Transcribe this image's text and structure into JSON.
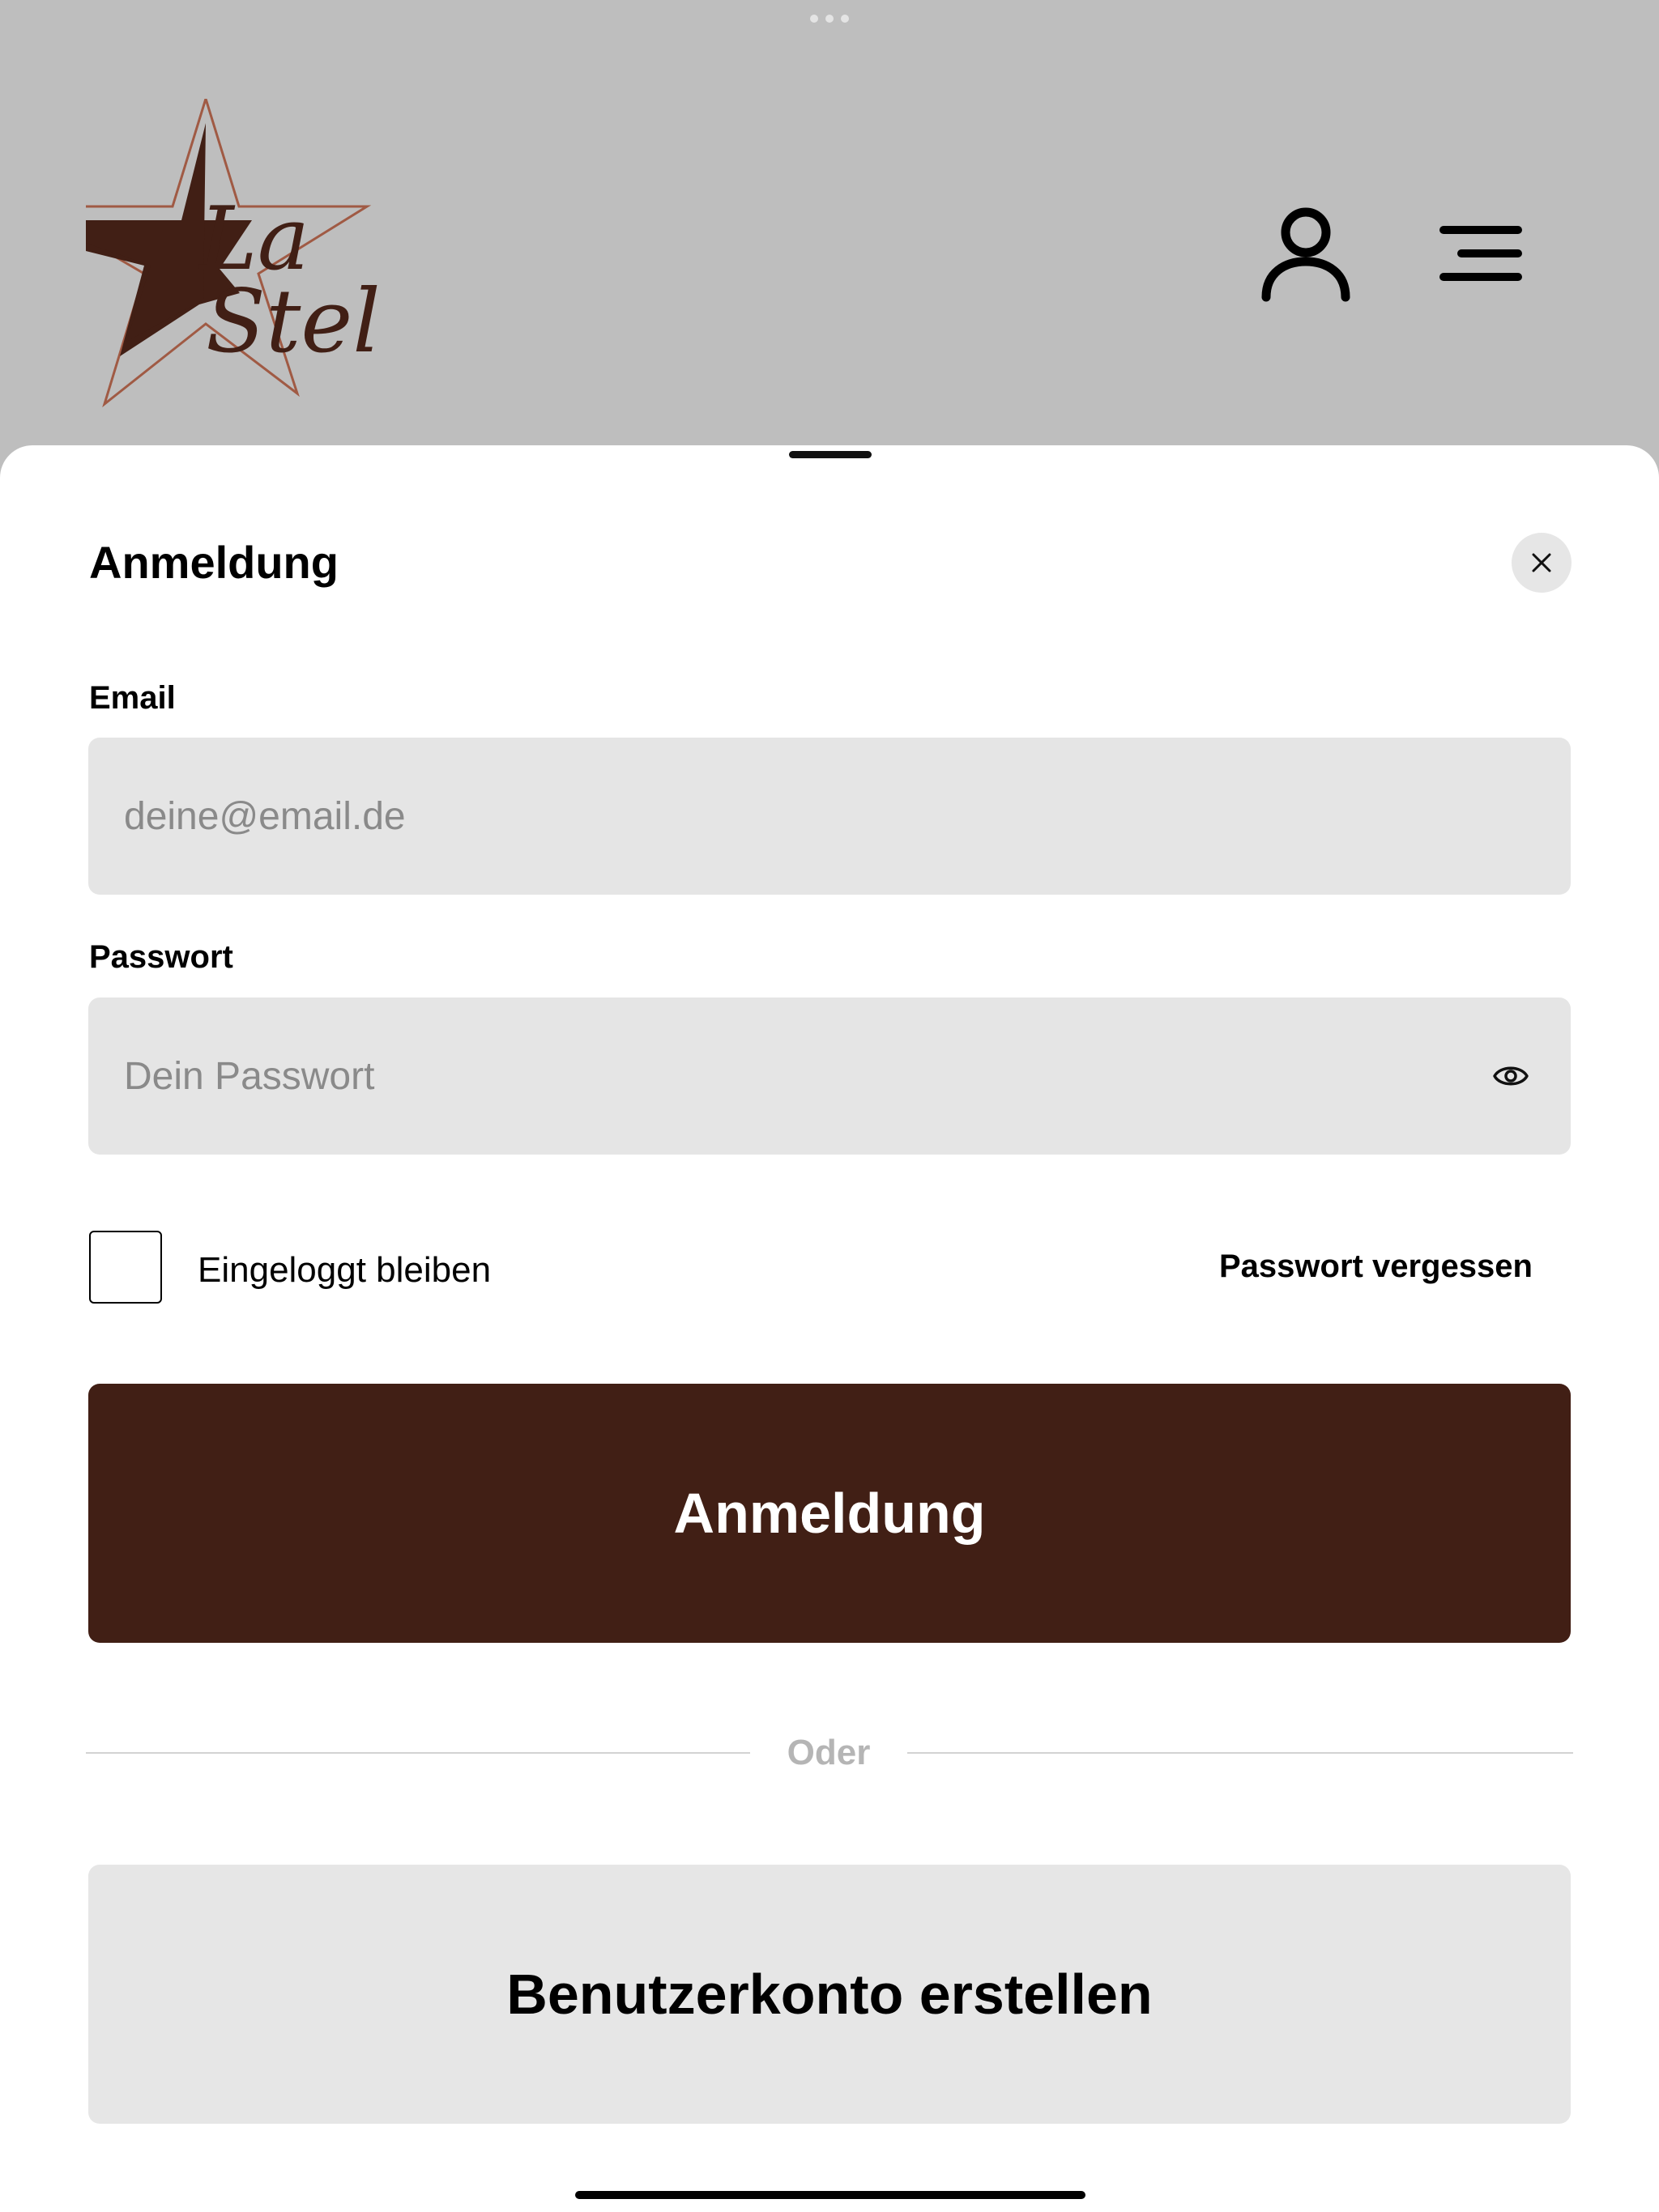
{
  "header": {
    "logo_alt": "La Stella",
    "logo_text_line1": "La",
    "logo_text_line2": "Stel",
    "user_icon": "user-icon",
    "menu_icon": "menu-icon"
  },
  "login_sheet": {
    "title": "Anmeldung",
    "close_icon": "close-icon",
    "email": {
      "label": "Email",
      "placeholder": "deine@email.de",
      "value": ""
    },
    "password": {
      "label": "Passwort",
      "placeholder": "Dein Passwort",
      "value": "",
      "toggle_icon": "eye-icon"
    },
    "remember_me": {
      "label": "Eingeloggt bleiben",
      "checked": false
    },
    "forgot_password_label": "Passwort vergessen",
    "login_button_label": "Anmeldung",
    "divider_text": "Oder",
    "register_button_label": "Benutzerkonto erstellen"
  },
  "colors": {
    "header_background": "#bebebe",
    "primary_brown": "#411f15",
    "input_background": "#e5e5e5",
    "secondary_button_background": "#e6e6e6",
    "divider_text": "#b5b5b5"
  }
}
